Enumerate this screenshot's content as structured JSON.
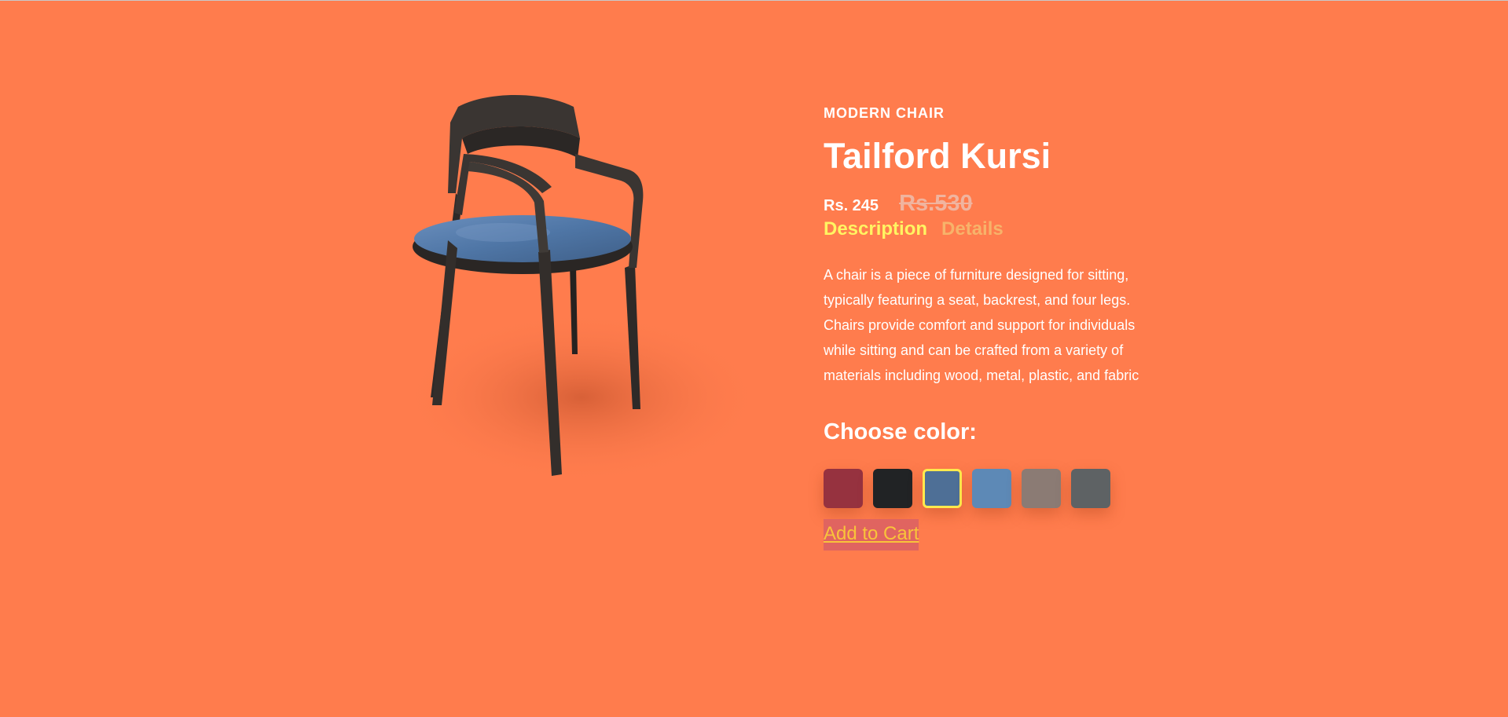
{
  "product": {
    "category": "MODERN CHAIR",
    "title": "Tailford Kursi",
    "price": "Rs. 245",
    "old_price": "Rs.530",
    "image_alt": "chair-image"
  },
  "tabs": [
    {
      "label": "Description",
      "active": true
    },
    {
      "label": "Details",
      "active": false
    }
  ],
  "description": "A chair is a piece of furniture designed for sitting, typically featuring a seat, backrest, and four legs. Chairs provide comfort and support for individuals while sitting and can be crafted from a variety of materials including wood, metal, plastic, and fabric",
  "color_picker": {
    "label": "Choose color:",
    "swatches": [
      {
        "color": "#96323f",
        "selected": false
      },
      {
        "color": "#212325",
        "selected": false
      },
      {
        "color": "#4e6f96",
        "selected": true
      },
      {
        "color": "#5d89b6",
        "selected": false
      },
      {
        "color": "#8b7b74",
        "selected": false
      },
      {
        "color": "#5e6264",
        "selected": false
      }
    ]
  },
  "cart_button": "Add to Cart",
  "colors": {
    "background": "#ff7c4d",
    "active_tab": "#fff462",
    "inactive_tab": "#f7b36a",
    "cart_bg": "#e06460",
    "cart_text": "#f9c33a"
  }
}
